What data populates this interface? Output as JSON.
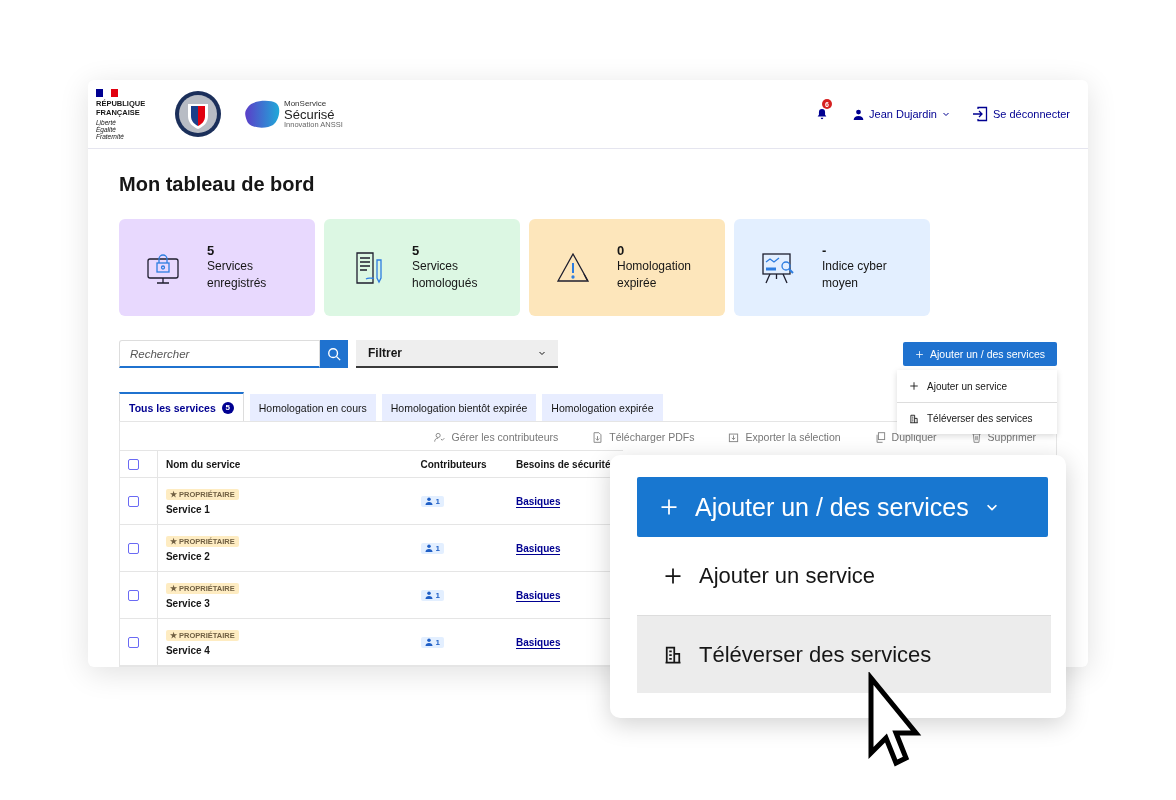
{
  "header": {
    "republic": "RÉPUBLIQUE\nFRANÇAISE",
    "motto": "Liberté\nÉgalité\nFraternité",
    "product_top": "MonService",
    "product_name": "Sécurisé",
    "product_sub": "Innovation ANSSI",
    "notifications": "6",
    "user": "Jean Dujardin",
    "logout": "Se déconnecter"
  },
  "title": "Mon tableau de bord",
  "stats": [
    {
      "kind": "lock",
      "value": "5",
      "label": "Services\nenregistrés",
      "color": "#e8d9fe"
    },
    {
      "kind": "document",
      "value": "5",
      "label": "Services\nhomologués",
      "color": "#dcf7e3"
    },
    {
      "kind": "warning",
      "value": "0",
      "label": "Homologation\nexpirée",
      "color": "#fde6bb"
    },
    {
      "kind": "board",
      "value": "-",
      "label": "Indice cyber\nmoyen",
      "color": "#e3efff"
    }
  ],
  "search": {
    "placeholder": "Rechercher"
  },
  "filter": "Filtrer",
  "add_button": "Ajouter un / des services",
  "add_menu": [
    {
      "kind": "plus",
      "label": "Ajouter un service"
    },
    {
      "kind": "building",
      "label": "Téléverser des services"
    }
  ],
  "tabs": [
    {
      "label": "Tous les services",
      "count": "5",
      "selected": true
    },
    {
      "label": "Homologation en cours",
      "selected": false
    },
    {
      "label": "Homologation bientôt expirée",
      "selected": false
    },
    {
      "label": "Homologation expirée",
      "selected": false
    }
  ],
  "actions": [
    {
      "kind": "people",
      "label": "Gérer les contributeurs"
    },
    {
      "kind": "file",
      "label": "Télécharger PDFs"
    },
    {
      "kind": "export",
      "label": "Exporter la sélection"
    },
    {
      "kind": "copy",
      "label": "Dupliquer"
    },
    {
      "kind": "trash",
      "label": "Supprimer"
    }
  ],
  "table": {
    "select_all_checked": false,
    "columns": [
      "Nom du service",
      "Contributeurs",
      "Besoins de sécurité"
    ],
    "rows": [
      {
        "checked": false,
        "badge": "★ PROPRIÉTAIRE",
        "name": "Service 1",
        "contributors": "1",
        "needs": "Basiques"
      },
      {
        "checked": false,
        "badge": "★ PROPRIÉTAIRE",
        "name": "Service 2",
        "contributors": "1",
        "needs": "Basiques"
      },
      {
        "checked": false,
        "badge": "★ PROPRIÉTAIRE",
        "name": "Service 3",
        "contributors": "1",
        "needs": "Basiques"
      },
      {
        "checked": false,
        "badge": "★ PROPRIÉTAIRE",
        "name": "Service 4",
        "contributors": "1",
        "needs": "Basiques"
      }
    ]
  },
  "zoom": {
    "button": "Ajouter un / des services",
    "items": [
      {
        "kind": "plus",
        "label": "Ajouter un service",
        "selected": false
      },
      {
        "kind": "building",
        "label": "Téléverser des services",
        "selected": true
      }
    ]
  }
}
